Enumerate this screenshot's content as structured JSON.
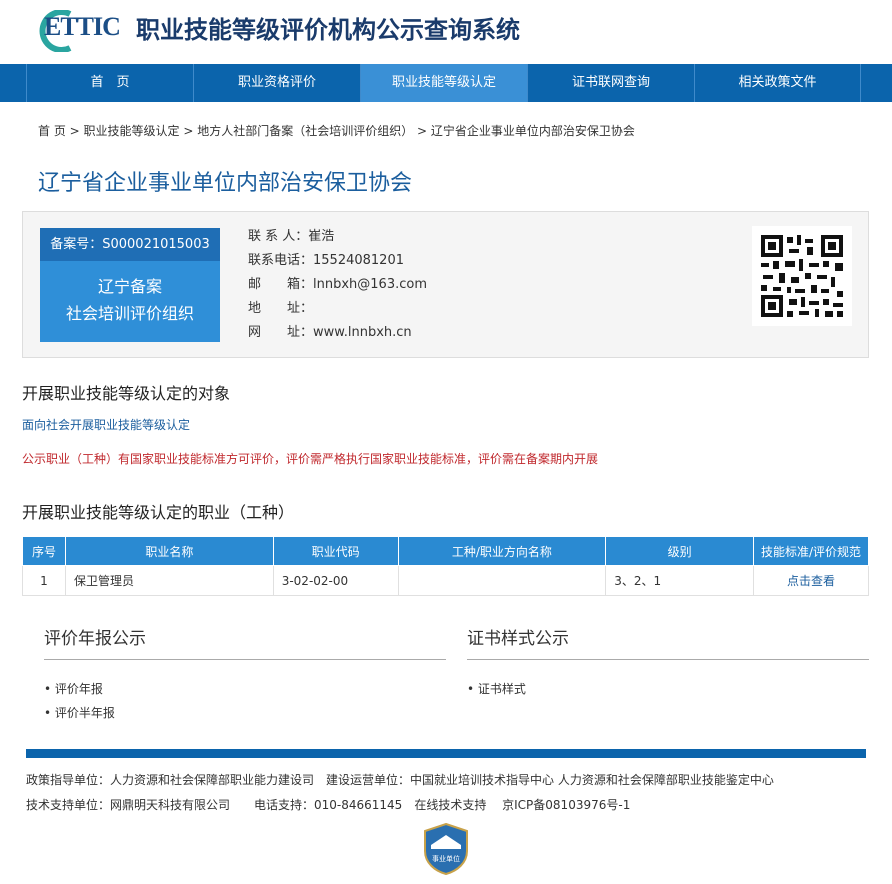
{
  "header": {
    "logo_text": "ETTIC",
    "title": "职业技能等级评价机构公示查询系统"
  },
  "nav": [
    {
      "label": "首　页"
    },
    {
      "label": "职业资格评价"
    },
    {
      "label": "职业技能等级认定"
    },
    {
      "label": "证书联网查询"
    },
    {
      "label": "相关政策文件"
    }
  ],
  "breadcrumb": {
    "items": [
      "首 页",
      "职业技能等级认定",
      "地方人社部门备案（社会培训评价组织）",
      "辽宁省企业事业单位内部治安保卫协会"
    ],
    "sep": " > "
  },
  "org": {
    "name": "辽宁省企业事业单位内部治安保卫协会",
    "record_label": "备案号：S000021015003",
    "badge_line1": "辽宁备案",
    "badge_line2": "社会培训评价组织",
    "contact_label": "联 系 人：",
    "contact": "崔浩",
    "phone_label": "联系电话：",
    "phone": "15524081201",
    "email_label": "邮　　箱：",
    "email": "lnnbxh@163.com",
    "address_label": "地　　址：",
    "address": "",
    "site_label": "网　　址：",
    "site": "www.lnnbxh.cn"
  },
  "scope": {
    "heading": "开展职业技能等级认定的对象",
    "text": "面向社会开展职业技能等级认定",
    "notice": "公示职业（工种）有国家职业技能标准方可评价，评价需严格执行国家职业技能标准，评价需在备案期内开展"
  },
  "occupations": {
    "heading": "开展职业技能等级认定的职业（工种）",
    "columns": [
      "序号",
      "职业名称",
      "职业代码",
      "工种/职业方向名称",
      "级别",
      "技能标准/评价规范"
    ],
    "rows": [
      {
        "no": "1",
        "name": "保卫管理员",
        "code": "3-02-02-00",
        "direction": "",
        "level": "3、2、1",
        "action": "点击查看"
      }
    ]
  },
  "annual": {
    "heading": "评价年报公示",
    "items": [
      "• 评价年报",
      "• 评价半年报"
    ]
  },
  "cert": {
    "heading": "证书样式公示",
    "items": [
      "• 证书样式"
    ]
  },
  "footer": {
    "line1": "政策指导单位：人力资源和社会保障部职业能力建设司　建设运营单位：中国就业培训技术指导中心  人力资源和社会保障部职业技能鉴定中心",
    "line2": "技术支持单位：网鼎明天科技有限公司　　电话支持：010-84661145　在线技术支持　 京ICP备08103976号-1",
    "emblem_text": "事业单位"
  },
  "colors": {
    "nav": "#0b64ac",
    "nav_active": "#3a90d6",
    "title_blue": "#1b5e9e",
    "notice_red": "#c0282d"
  }
}
